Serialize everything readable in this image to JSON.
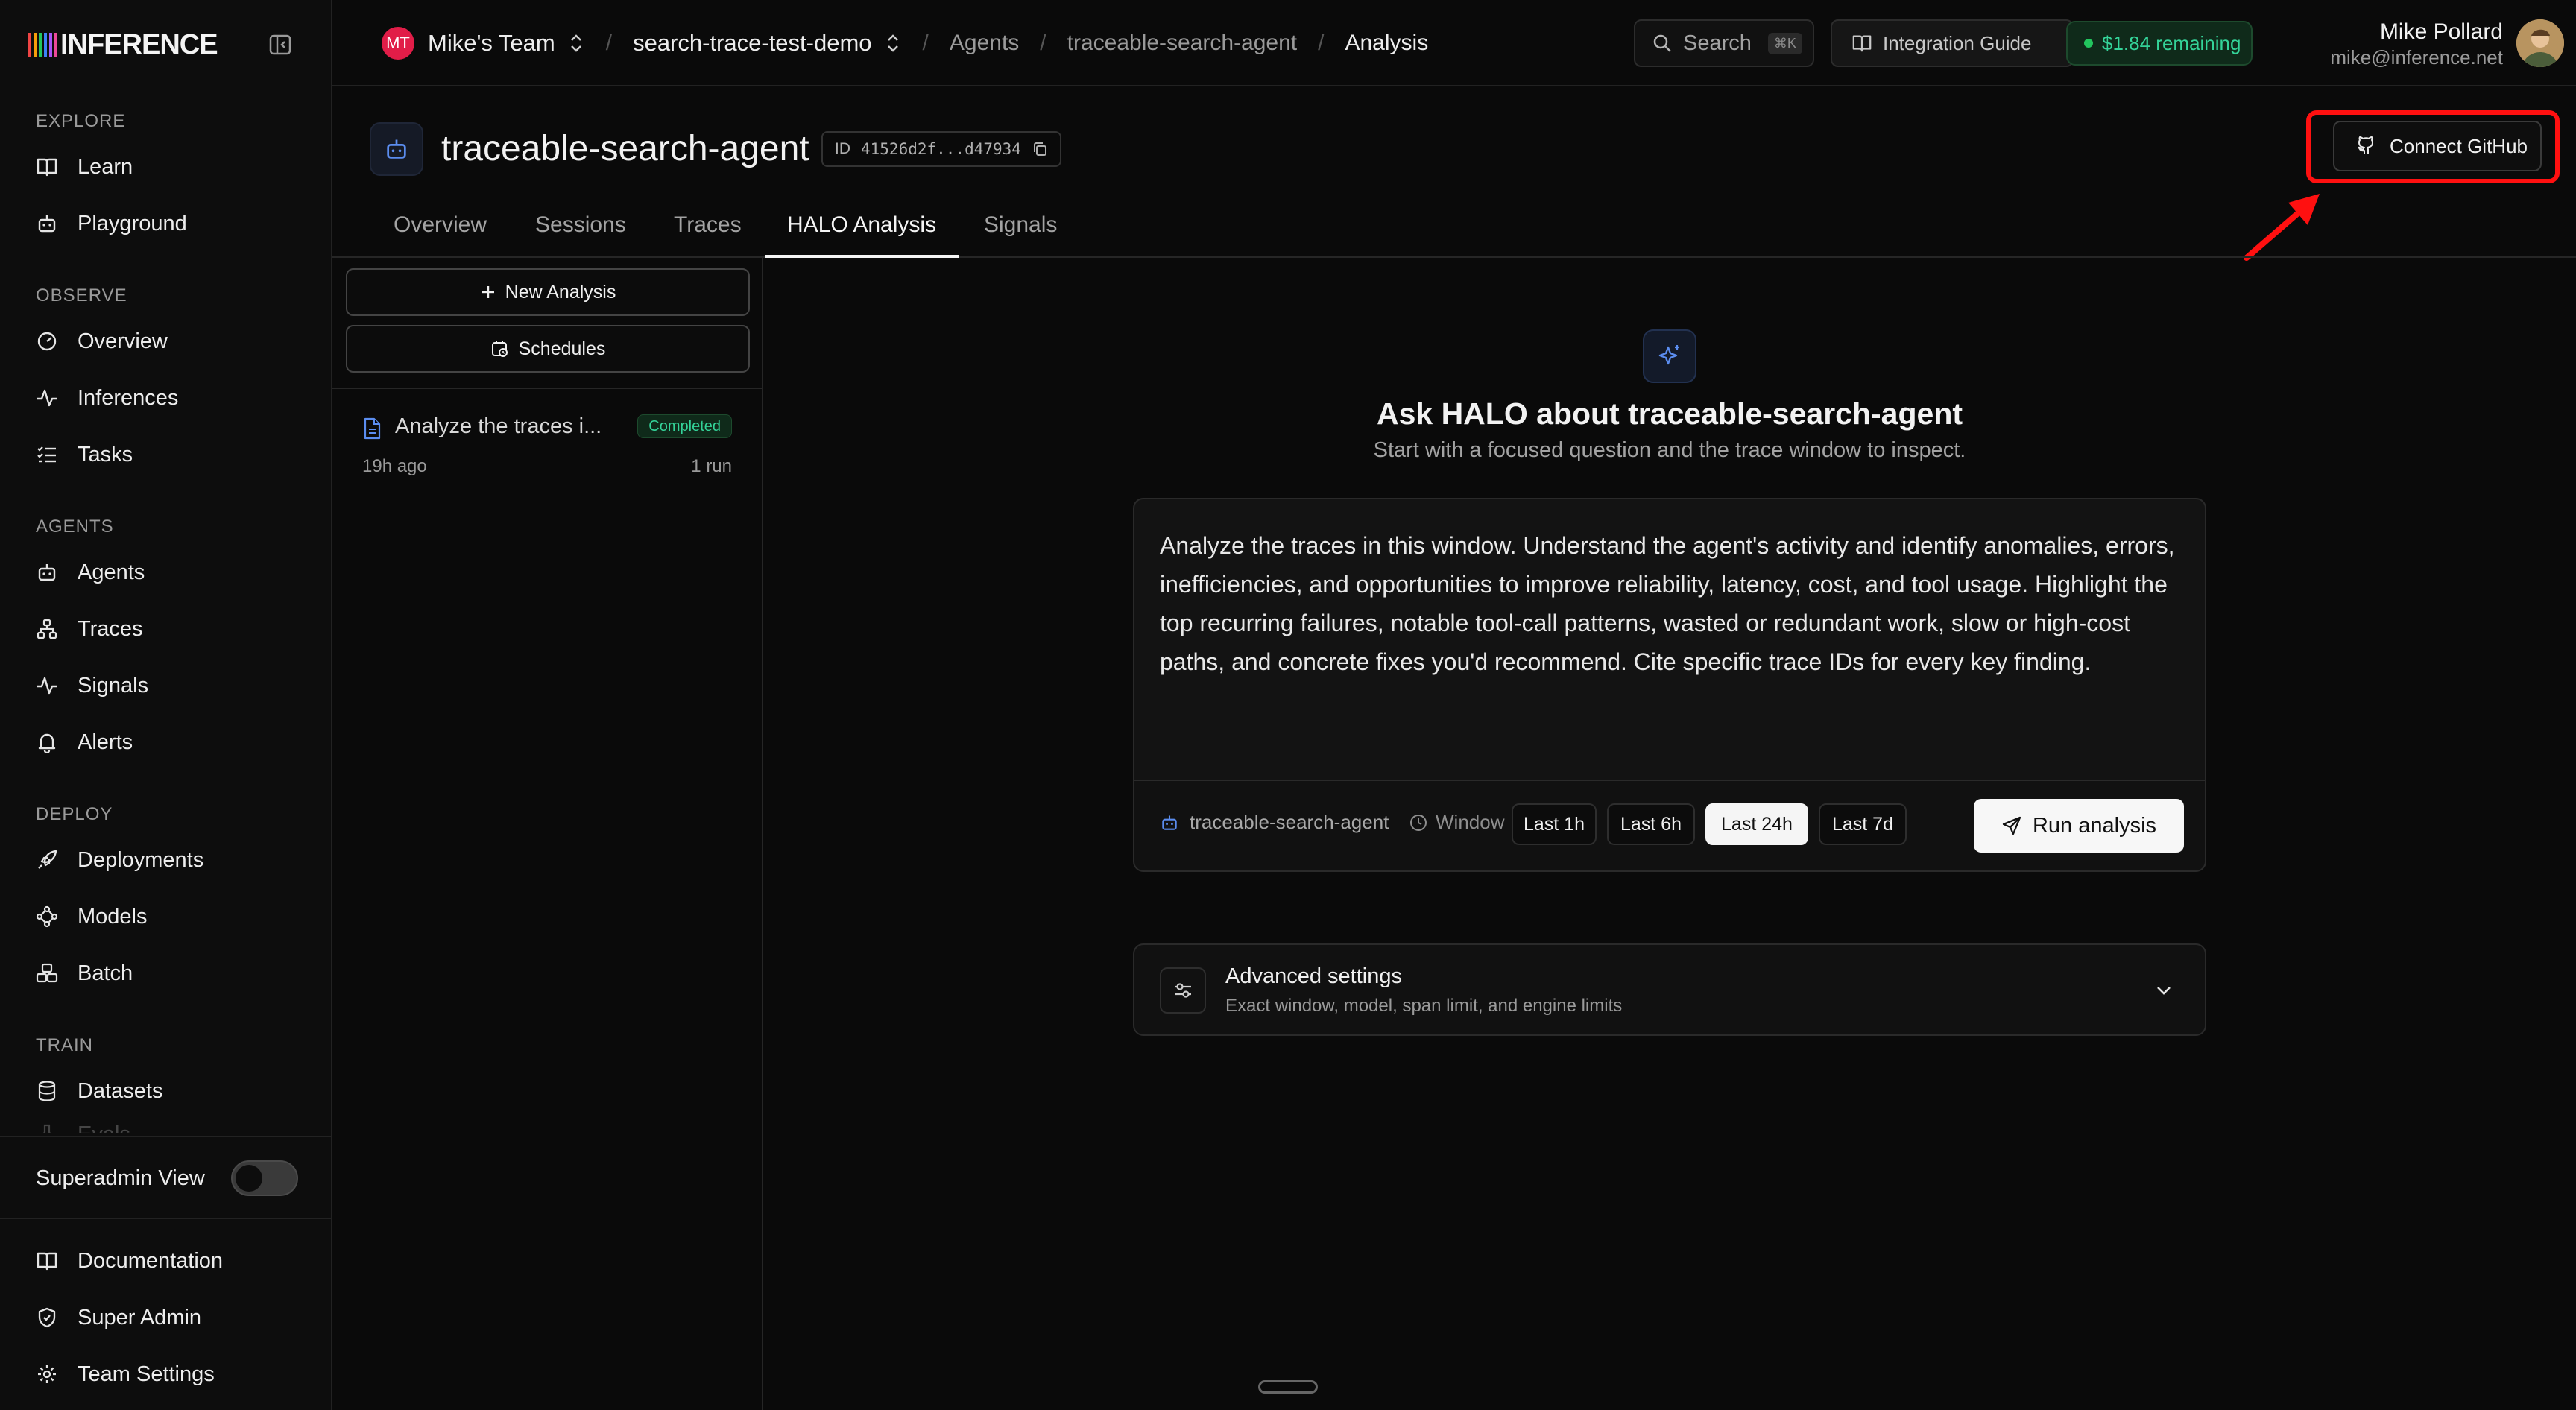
{
  "brand": {
    "name": "INFERENCE",
    "bar_colors": [
      "#ef4444",
      "#f59e0b",
      "#22c55e",
      "#3b82f6",
      "#a855f7",
      "#ec4899"
    ]
  },
  "sidebar": {
    "sections": [
      {
        "title": "EXPLORE",
        "items": [
          {
            "label": "Learn",
            "icon": "book-icon"
          },
          {
            "label": "Playground",
            "icon": "robot-icon"
          }
        ]
      },
      {
        "title": "OBSERVE",
        "items": [
          {
            "label": "Overview",
            "icon": "gauge-icon"
          },
          {
            "label": "Inferences",
            "icon": "activity-icon"
          },
          {
            "label": "Tasks",
            "icon": "list-checks-icon"
          }
        ]
      },
      {
        "title": "AGENTS",
        "items": [
          {
            "label": "Agents",
            "icon": "robot-icon"
          },
          {
            "label": "Traces",
            "icon": "network-icon"
          },
          {
            "label": "Signals",
            "icon": "activity-icon"
          },
          {
            "label": "Alerts",
            "icon": "bell-icon"
          }
        ]
      },
      {
        "title": "DEPLOY",
        "items": [
          {
            "label": "Deployments",
            "icon": "rocket-icon"
          },
          {
            "label": "Models",
            "icon": "nodes-icon"
          },
          {
            "label": "Batch",
            "icon": "boxes-icon"
          }
        ]
      },
      {
        "title": "TRAIN",
        "items": [
          {
            "label": "Datasets",
            "icon": "database-icon"
          },
          {
            "label": "Evals",
            "icon": "flask-icon"
          }
        ]
      }
    ],
    "superadmin_label": "Superadmin View",
    "superadmin_on": false,
    "bottom_items": [
      {
        "label": "Documentation",
        "icon": "book-icon"
      },
      {
        "label": "Super Admin",
        "icon": "shield-icon"
      },
      {
        "label": "Team Settings",
        "icon": "gear-icon"
      }
    ]
  },
  "header": {
    "team_initials": "MT",
    "team_name": "Mike's Team",
    "project": "search-trace-test-demo",
    "breadcrumbs": [
      "Agents",
      "traceable-search-agent",
      "Analysis"
    ],
    "search_label": "Search",
    "search_shortcut": "⌘K",
    "guide_label": "Integration Guide",
    "credit_label": "$1.84 remaining",
    "user_name": "Mike Pollard",
    "user_email": "mike@inference.net"
  },
  "agent": {
    "name": "traceable-search-agent",
    "id_label": "ID",
    "id_value": "41526d2f...d47934",
    "connect_label": "Connect GitHub"
  },
  "tabs": [
    "Overview",
    "Sessions",
    "Traces",
    "HALO Analysis",
    "Signals"
  ],
  "active_tab": "HALO Analysis",
  "left_panel": {
    "new_analysis_label": "New Analysis",
    "schedules_label": "Schedules",
    "runs": [
      {
        "title": "Analyze the traces i...",
        "status": "Completed",
        "time": "19h ago",
        "count": "1 run"
      }
    ]
  },
  "main": {
    "heading": "Ask HALO about traceable-search-agent",
    "subheading": "Start with a focused question and the trace window to inspect.",
    "prompt": "Analyze the traces in this window. Understand the agent's activity and identify anomalies, errors, inefficiencies, and opportunities to improve reliability, latency, cost, and tool usage. Highlight the top recurring failures, notable tool-call patterns, wasted or redundant work, slow or high-cost paths, and concrete fixes you'd recommend. Cite specific trace IDs for every key finding.",
    "agent_chip": "traceable-search-agent",
    "window_label": "Window",
    "windows": [
      "Last 1h",
      "Last 6h",
      "Last 24h",
      "Last 7d"
    ],
    "active_window": "Last 24h",
    "run_label": "Run analysis",
    "advanced_title": "Advanced settings",
    "advanced_sub": "Exact window, model, span limit, and engine limits"
  },
  "annotation_color": "#ff1010"
}
